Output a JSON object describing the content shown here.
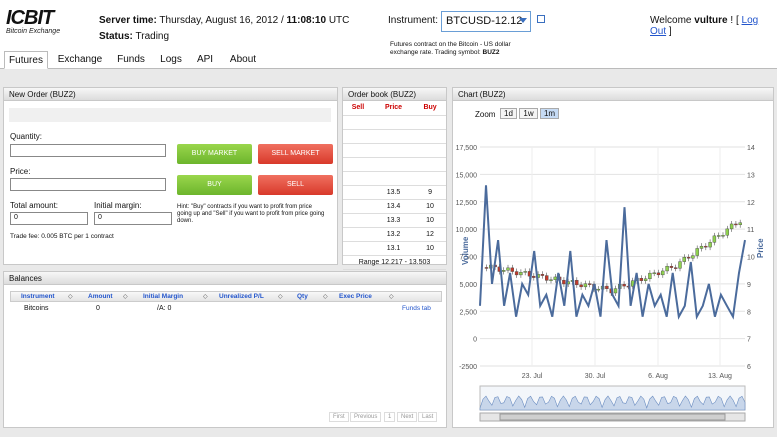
{
  "brand": {
    "name": "ICBIT",
    "tagline": "Bitcoin Exchange"
  },
  "server": {
    "time_label": "Server time:",
    "date": "Thursday, August 16, 2012 /",
    "time": "11:08:10",
    "tz": "UTC",
    "status_label": "Status:",
    "status": "Trading"
  },
  "instrument": {
    "label": "Instrument:",
    "selected": "BTCUSD-12.12",
    "description": "Futures contract on the Bitcoin - US dollar exchange rate. Trading symbol:",
    "symbol": "BUZ2"
  },
  "user": {
    "welcome": "Welcome",
    "name": "vulture",
    "bang": "!",
    "lb": "[",
    "logout": "Log Out",
    "rb": "]"
  },
  "tabs": [
    "Futures",
    "Exchange",
    "Funds",
    "Logs",
    "API",
    "About"
  ],
  "order": {
    "title": "New Order (BUZ2)",
    "quantity_label": "Quantity:",
    "price_label": "Price:",
    "total_label": "Total amount:",
    "total_value": "0",
    "margin_label": "Initial margin:",
    "margin_value": "0",
    "buy_market": "BUY MARKET",
    "sell_market": "SELL MARKET",
    "buy": "BUY",
    "sell": "SELL",
    "hint": "Hint: \"Buy\" contracts if you want to profit from price going up and \"Sell\" if you want to profit from price going down.",
    "fee": "Trade fee: 0.005 BTC per 1 contract"
  },
  "orderbook": {
    "title": "Order book (BUZ2)",
    "cols": [
      "Sell",
      "Price",
      "Buy"
    ],
    "rows": [
      [
        "",
        "13.5",
        "9"
      ],
      [
        "",
        "13.4",
        "10"
      ],
      [
        "",
        "13.3",
        "10"
      ],
      [
        "",
        "13.2",
        "12"
      ],
      [
        "",
        "13.1",
        "10"
      ]
    ],
    "range": "Range 12.217 - 13.503"
  },
  "balances": {
    "title": "Balances",
    "cols": [
      "Instrument",
      "Amount",
      "Initial Margin",
      "Unrealized P/L",
      "Qty",
      "Exec Price"
    ],
    "row": {
      "instrument": "Bitcoins",
      "amount": "0",
      "margin": "/A: 0"
    },
    "funds_link": "Funds tab",
    "pager": [
      "First",
      "Previous",
      "1",
      "Next",
      "Last"
    ]
  },
  "chart": {
    "title": "Chart (BUZ2)",
    "zoom_label": "Zoom",
    "zoom_options": [
      "1d",
      "1w",
      "1m"
    ],
    "zoom_selected": "1m",
    "left_ticks": [
      "17,500",
      "15,000",
      "12,500",
      "10,000",
      "7,500",
      "5,000",
      "2,500",
      "0",
      "-2500"
    ],
    "right_ticks": [
      "14",
      "13",
      "12",
      "11",
      "10",
      "9",
      "8",
      "7",
      "6"
    ],
    "x_ticks": [
      "23. Jul",
      "30. Jul",
      "6. Aug",
      "13. Aug"
    ],
    "ylabel_left": "Volume",
    "ylabel_right": "Price",
    "colors": {
      "volume": "#4b6b9c",
      "up": "#8fd14f",
      "down": "#c0392b"
    }
  },
  "chart_data": {
    "type": "line",
    "x": [
      "23. Jul",
      "30. Jul",
      "6. Aug",
      "13. Aug"
    ],
    "series": [],
    "ylim": [
      -2500,
      17500
    ],
    "y2lim": [
      6,
      14
    ],
    "ylabel": "Volume",
    "y2label": "Price"
  }
}
